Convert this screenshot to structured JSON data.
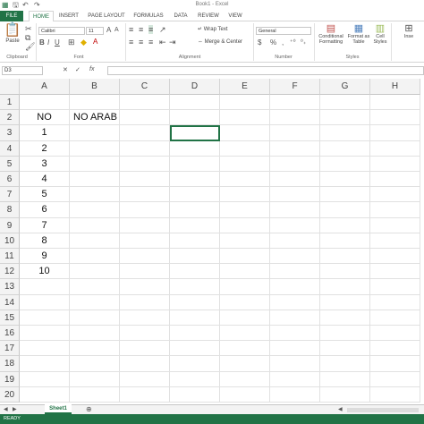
{
  "window": {
    "title": "Book1 - Excel"
  },
  "ribbon": {
    "tabs": [
      "FILE",
      "HOME",
      "INSERT",
      "PAGE LAYOUT",
      "FORMULAS",
      "DATA",
      "REVIEW",
      "VIEW"
    ],
    "active_tab": "HOME",
    "clipboard": {
      "paste_label": "Paste",
      "group_label": "Clipboard"
    },
    "font": {
      "name": "Calibri",
      "size": "11",
      "group_label": "Font"
    },
    "alignment": {
      "wrap_text": "Wrap Text",
      "merge_center": "Merge & Center",
      "group_label": "Alignment"
    },
    "number": {
      "format": "General",
      "currency": "$",
      "percent": "%",
      "comma": ",",
      "group_label": "Number"
    },
    "styles": {
      "conditional_formatting": "Conditional Formatting",
      "format_as_table": "Format as Table",
      "cell_styles": "Cell Styles",
      "group_label": "Styles"
    },
    "cells": {
      "insert": "Inse"
    }
  },
  "formula_bar": {
    "name_box": "D3",
    "fx": "fx",
    "content": ""
  },
  "grid": {
    "columns": [
      "A",
      "B",
      "C",
      "D",
      "E",
      "F",
      "G",
      "H"
    ],
    "rows": [
      "1",
      "2",
      "3",
      "4",
      "5",
      "6",
      "7",
      "8",
      "9",
      "10",
      "11",
      "12",
      "13",
      "14",
      "15",
      "16",
      "17",
      "18",
      "19",
      "20"
    ],
    "cells": {
      "A2": "NO",
      "B2": "NO ARAB",
      "A3": "1",
      "A4": "2",
      "A5": "3",
      "A6": "4",
      "A7": "5",
      "A8": "6",
      "A9": "7",
      "A10": "8",
      "A11": "9",
      "A12": "10"
    },
    "selected_cell": "D3"
  },
  "sheets": {
    "tabs": [
      "Sheet1"
    ],
    "add_icon": "plus-circle-icon"
  },
  "status": {
    "text": "READY"
  },
  "colors": {
    "accent": "#217346"
  }
}
